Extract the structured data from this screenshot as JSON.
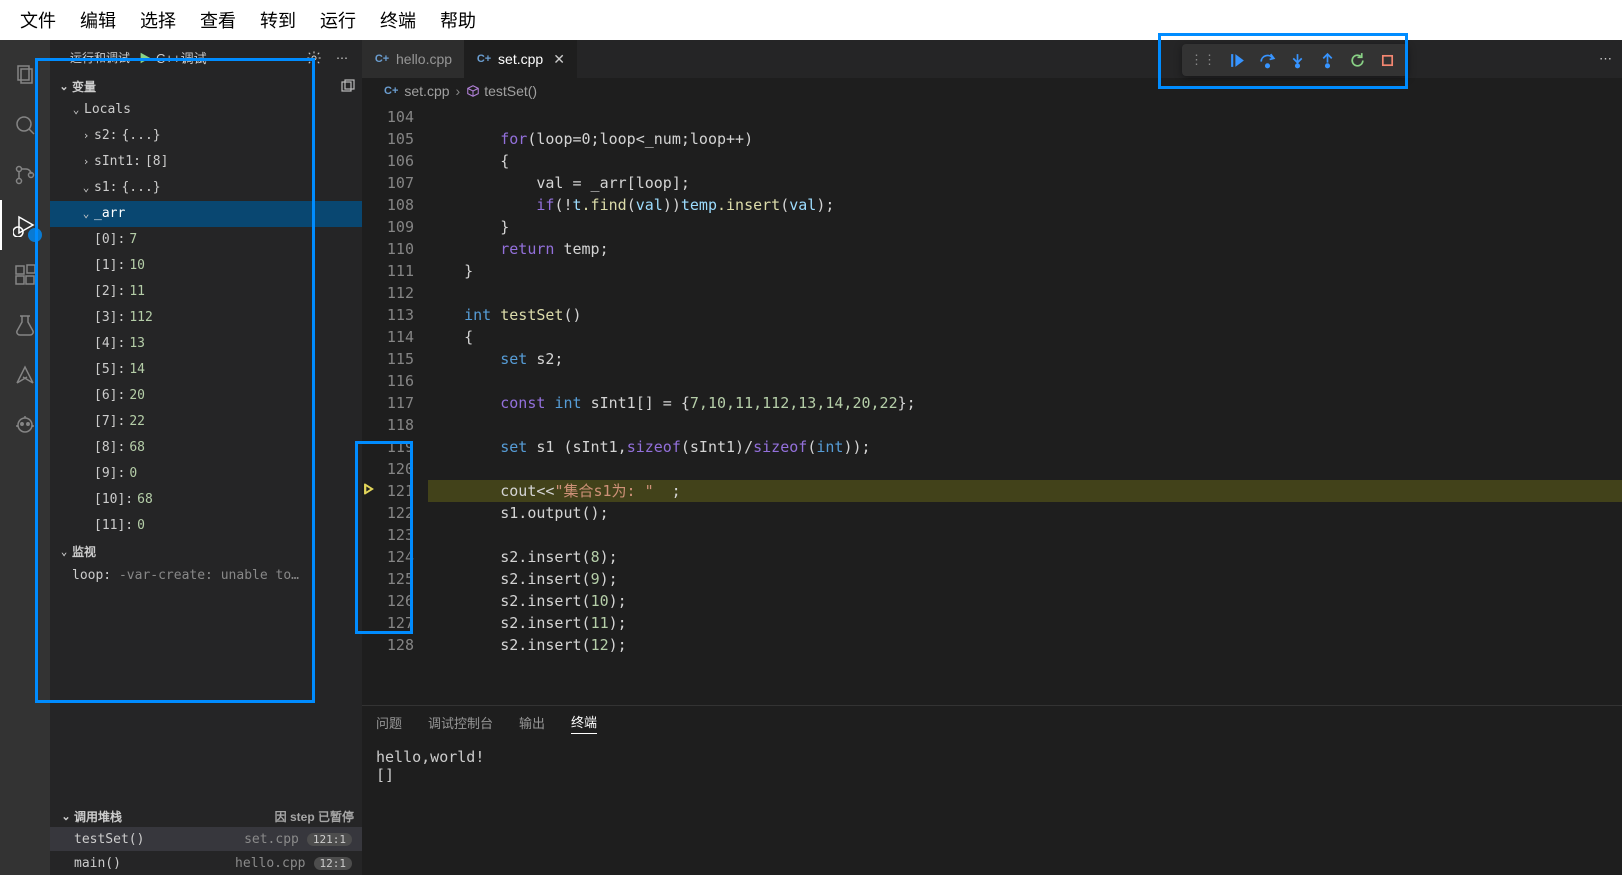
{
  "menu": [
    "文件",
    "编辑",
    "选择",
    "查看",
    "转到",
    "运行",
    "终端",
    "帮助"
  ],
  "runDebug": {
    "title": "运行和调试",
    "config": "C++调试"
  },
  "varSection": "变量",
  "locals": "Locals",
  "vars": {
    "s2": {
      "name": "s2:",
      "val": "{...}"
    },
    "sInt1": {
      "name": "sInt1:",
      "val": "[8]"
    },
    "s1": {
      "name": "s1:",
      "val": "{...}"
    },
    "arr": {
      "name": "_arr"
    }
  },
  "arrItems": [
    {
      "k": "[0]:",
      "v": "7"
    },
    {
      "k": "[1]:",
      "v": "10"
    },
    {
      "k": "[2]:",
      "v": "11"
    },
    {
      "k": "[3]:",
      "v": "112"
    },
    {
      "k": "[4]:",
      "v": "13"
    },
    {
      "k": "[5]:",
      "v": "14"
    },
    {
      "k": "[6]:",
      "v": "20"
    },
    {
      "k": "[7]:",
      "v": "22"
    },
    {
      "k": "[8]:",
      "v": "68"
    },
    {
      "k": "[9]:",
      "v": "0"
    },
    {
      "k": "[10]:",
      "v": "68"
    },
    {
      "k": "[11]:",
      "v": "0"
    }
  ],
  "watchSection": "监视",
  "watch": {
    "name": "loop:",
    "msg": "-var-create: unable to…"
  },
  "callStackSection": "调用堆栈",
  "callStackReason": "因 step 已暂停",
  "callStack": [
    {
      "fn": "testSet()",
      "src": "set.cpp",
      "pos": "121:1"
    },
    {
      "fn": "main()",
      "src": "hello.cpp",
      "pos": "12:1"
    }
  ],
  "tabs": [
    {
      "name": "hello.cpp",
      "active": false
    },
    {
      "name": "set.cpp",
      "active": true
    }
  ],
  "breadcrumb": {
    "file": "set.cpp",
    "symbol": "testSet()"
  },
  "lines": [
    104,
    105,
    106,
    107,
    108,
    109,
    110,
    111,
    112,
    113,
    114,
    115,
    116,
    117,
    118,
    119,
    120,
    121,
    122,
    123,
    124,
    125,
    126,
    127,
    128
  ],
  "execLine": 121,
  "code": {
    "l105": {
      "for": "for",
      "body": "(loop=0;loop<_num;loop++)"
    },
    "l107": "            val = _arr[loop];",
    "l108": {
      "if": "if",
      "find": ".find",
      "insert": ".insert",
      "val": "val",
      "t": "t",
      "temp": "temp"
    },
    "l110": {
      "kw": "return",
      "v": " temp;"
    },
    "l113": {
      "t": "int",
      "fn": " testSet",
      "paren": "()"
    },
    "l115": {
      "t": "set",
      "v": " s2;"
    },
    "l117": {
      "c": "const ",
      "t": "int ",
      "v": "sInt1[] = {",
      "nums": "7,10,11,112,13,14,20,22",
      "end": "};"
    },
    "l119": {
      "t": "set ",
      "v": "s1 (sInt1,",
      "so": "sizeof",
      "mid": "(sInt1)/",
      "so2": "sizeof",
      "t2": "int",
      "end": "));"
    },
    "l121": {
      "v1": "cout<<",
      "str": "\"集合s1为: \"",
      "v2": "  ;"
    },
    "l122": "s1.output();",
    "l124": {
      "v": "s2.insert(",
      "n": "8",
      "e": ");"
    },
    "l125": {
      "v": "s2.insert(",
      "n": "9",
      "e": ");"
    },
    "l126": {
      "v": "s2.insert(",
      "n": "10",
      "e": ");"
    },
    "l127": {
      "v": "s2.insert(",
      "n": "11",
      "e": ");"
    },
    "l128": {
      "v": "s2.insert(",
      "n": "12",
      "e": ");"
    }
  },
  "panelTabs": [
    "问题",
    "调试控制台",
    "输出",
    "终端"
  ],
  "panelActive": 3,
  "terminalOut": "hello,world!",
  "prompt": "[]"
}
